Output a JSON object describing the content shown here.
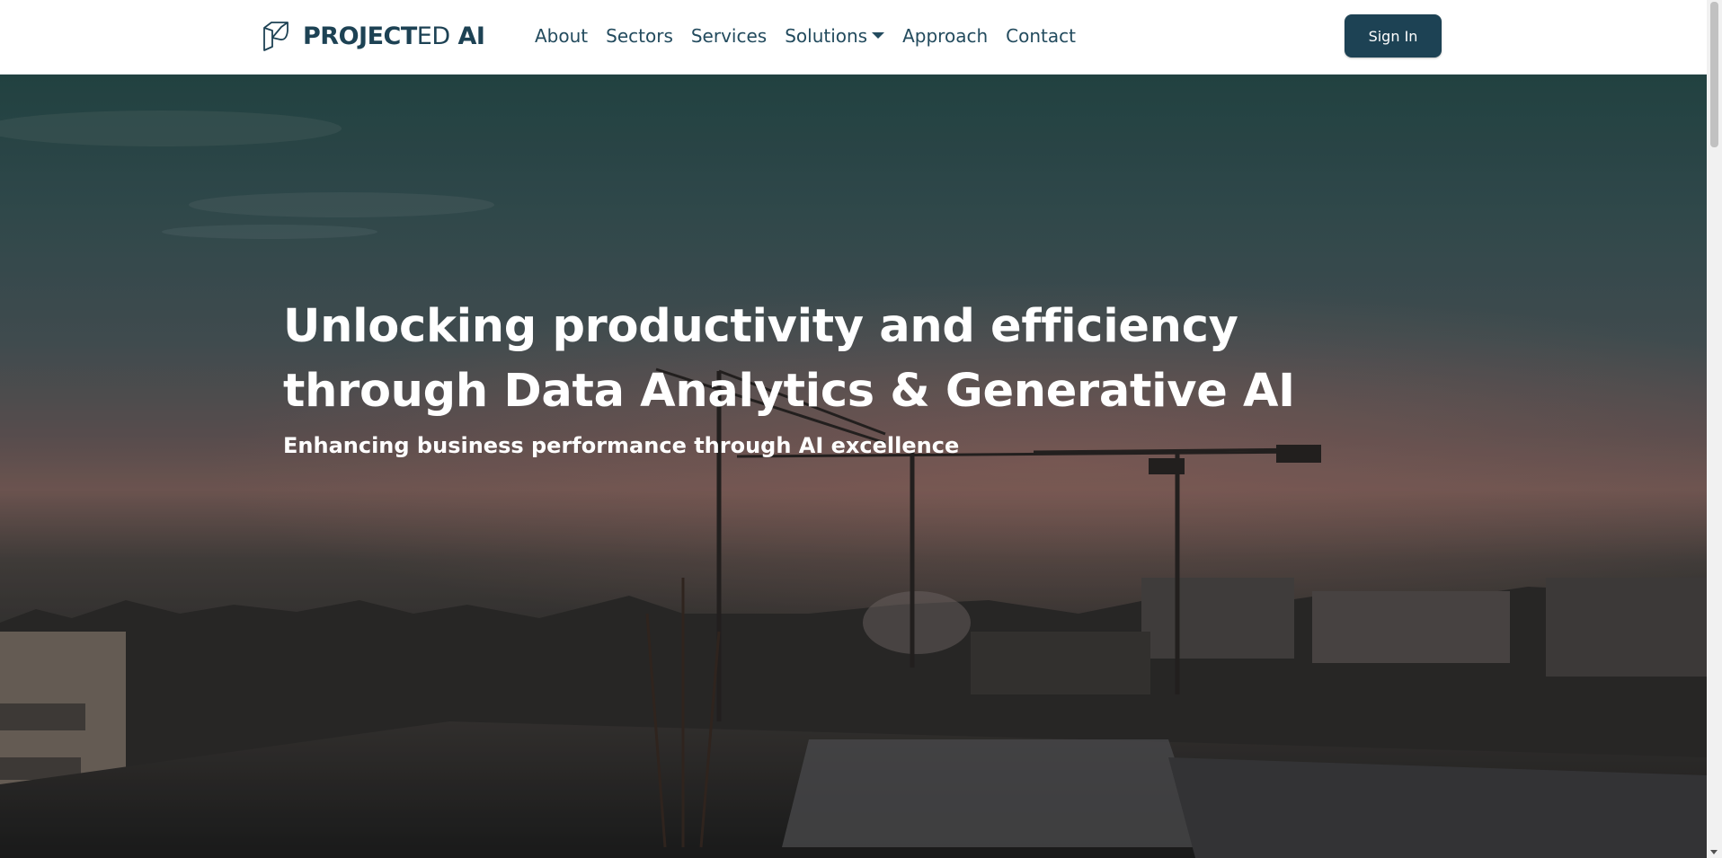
{
  "brand": {
    "name_bold": "PROJECT",
    "name_thin": "ED",
    "name_suffix": "AI",
    "icon": "logo-mark-icon",
    "color": "#1d4254"
  },
  "nav": {
    "items": [
      {
        "label": "About"
      },
      {
        "label": "Sectors"
      },
      {
        "label": "Services"
      },
      {
        "label": "Solutions",
        "has_dropdown": true,
        "icon": "caret-down-icon"
      },
      {
        "label": "Approach"
      },
      {
        "label": "Contact"
      }
    ],
    "text_color": "#234b5e"
  },
  "header": {
    "signin_label": "Sign In",
    "signin_color": "#1d4254"
  },
  "hero": {
    "title_line1": "Unlocking productivity and efficiency",
    "title_line2": "through Data Analytics & Generative AI",
    "subtitle": "Enhancing business performance through AI excellence",
    "background": "construction-site-dusk-photo"
  }
}
